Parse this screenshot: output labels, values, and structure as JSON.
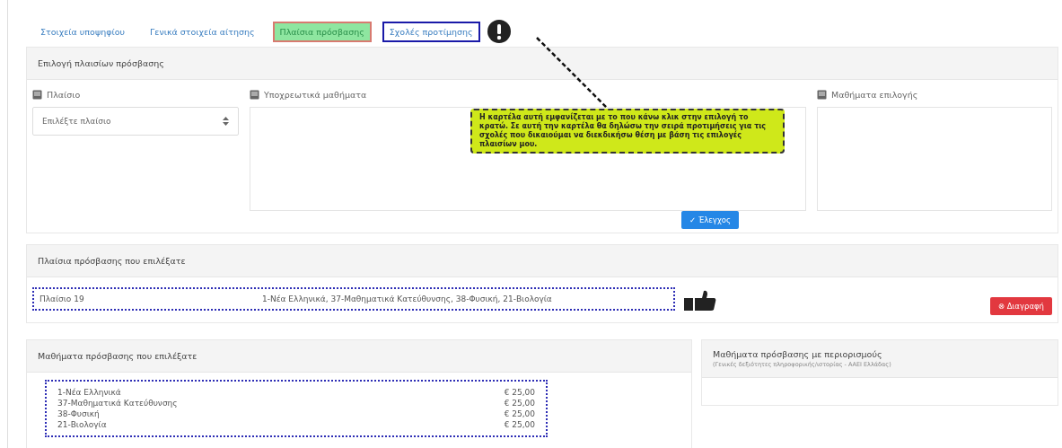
{
  "tabs": [
    {
      "label": "Στοιχεία υποψηφίου",
      "selected": false,
      "outlined": false
    },
    {
      "label": "Γενικά στοιχεία αίτησης",
      "selected": false,
      "outlined": false
    },
    {
      "label": "Πλαίσια πρόσβασης",
      "selected": true,
      "outlined": false
    },
    {
      "label": "Σχολές προτίμησης",
      "selected": false,
      "outlined": true
    }
  ],
  "selection_panel": {
    "title": "Επιλογή πλαισίων πρόσβασης",
    "frame": {
      "label": "Πλαίσιο",
      "select_placeholder": "Επιλέξτε πλαίσιο"
    },
    "mandatory": {
      "label": "Υποχρεωτικά μαθήματα"
    },
    "elective": {
      "label": "Μαθήματα επιλογής"
    },
    "check_button": "✓ Έλεγχος"
  },
  "callout": "Η καρτέλα αυτή εμφανίζεται με το που κάνω κλικ στην επιλογή το  κρατώ. Σε αυτή την καρτέλα θα δηλώσω την σειρά προτιμήσεις για τις σχολές που δικαιούμαι να διεκδικήσω θέση με βάση τις επιλογές πλαισίων μου.",
  "chosen_frames": {
    "title": "Πλαίσια πρόσβασης που επιλέξατε",
    "rows": [
      {
        "name": "Πλαίσιο 19",
        "courses": "1-Νέα Ελληνικά, 37-Μαθηματικά Κατεύθυνσης, 38-Φυσική, 21-Βιολογία"
      }
    ],
    "delete_button": "⊗ Διαγραφή"
  },
  "chosen_courses": {
    "title": "Μαθήματα πρόσβασης που επιλέξατε",
    "rows": [
      {
        "name": "1-Νέα Ελληνικά",
        "price": "€ 25,00"
      },
      {
        "name": "37-Μαθηματικά Κατεύθυνσης",
        "price": "€ 25,00"
      },
      {
        "name": "38-Φυσική",
        "price": "€ 25,00"
      },
      {
        "name": "21-Βιολογία",
        "price": "€ 25,00"
      }
    ]
  },
  "restricted_courses": {
    "title": "Μαθήματα πρόσβασης με περιορισμούς",
    "subtitle": "(Γενικές δεξιότητες πληροφορικής/ιστορίας - ΑΑΕΙ Ελλάδας)"
  }
}
